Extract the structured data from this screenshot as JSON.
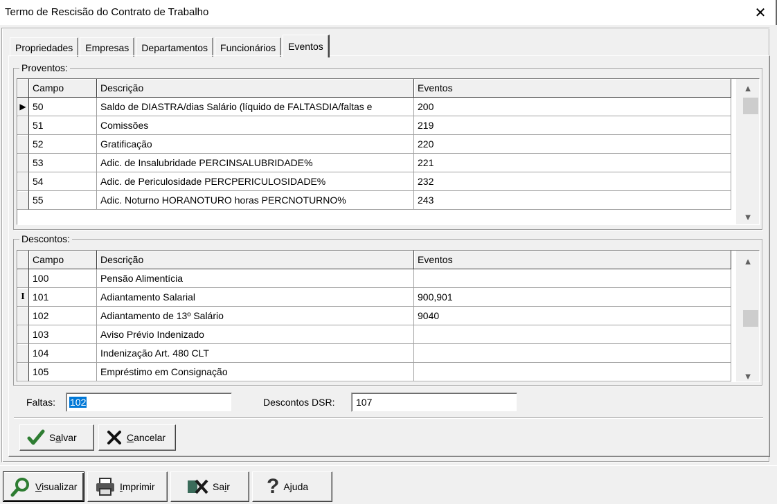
{
  "window": {
    "title": "Termo de Rescisão do Contrato de Trabalho",
    "close_glyph": "✕"
  },
  "tabs": [
    {
      "label": "Propriedades"
    },
    {
      "label": "Empresas"
    },
    {
      "label": "Departamentos"
    },
    {
      "label": "Funcionários"
    },
    {
      "label": "Eventos",
      "active": true
    }
  ],
  "proventos": {
    "label": "Proventos:",
    "columns": {
      "campo": "Campo",
      "descricao": "Descrição",
      "eventos": "Eventos"
    },
    "rows": [
      {
        "campo": "50",
        "descricao": "Saldo de DIASTRA/dias Salário (líquido de FALTASDIA/faltas e",
        "eventos": "200",
        "indicator": "▶"
      },
      {
        "campo": "51",
        "descricao": "Comissões",
        "eventos": "219"
      },
      {
        "campo": "52",
        "descricao": "Gratificação",
        "eventos": "220"
      },
      {
        "campo": "53",
        "descricao": "Adic. de Insalubridade PERCINSALUBRIDADE%",
        "eventos": "221"
      },
      {
        "campo": "54",
        "descricao": "Adic. de Periculosidade PERCPERICULOSIDADE%",
        "eventos": "232"
      },
      {
        "campo": "55",
        "descricao": "Adic. Noturno HORANOTURO horas PERCNOTURNO%",
        "eventos": "243"
      }
    ]
  },
  "descontos": {
    "label": "Descontos:",
    "columns": {
      "campo": "Campo",
      "descricao": "Descrição",
      "eventos": "Eventos"
    },
    "rows": [
      {
        "campo": "100",
        "descricao": "Pensão Alimentícia",
        "eventos": ""
      },
      {
        "campo": "101",
        "descricao": "Adiantamento Salarial",
        "eventos": "900,901",
        "indicator": "I"
      },
      {
        "campo": "102",
        "descricao": "Adiantamento de 13º Salário",
        "eventos": "9040"
      },
      {
        "campo": "103",
        "descricao": "Aviso Prévio Indenizado",
        "eventos": ""
      },
      {
        "campo": "104",
        "descricao": "Indenização Art. 480 CLT",
        "eventos": ""
      },
      {
        "campo": "105",
        "descricao": "Empréstimo em Consignação",
        "eventos": ""
      }
    ]
  },
  "fields": {
    "faltas_label": "Faltas:",
    "faltas_value": "102",
    "dsr_label": "Descontos DSR:",
    "dsr_value": "107"
  },
  "buttons": {
    "salvar_pre": "S",
    "salvar_u": "a",
    "salvar_post": "lvar",
    "cancelar_pre": "",
    "cancelar_u": "C",
    "cancelar_post": "ancelar",
    "visualizar_pre": "",
    "visualizar_u": "V",
    "visualizar_post": "isualizar",
    "imprimir_pre": "",
    "imprimir_u": "I",
    "imprimir_post": "mprimir",
    "sair_pre": "Sa",
    "sair_u": "i",
    "sair_post": "r",
    "ajuda_pre": "A",
    "ajuda_u": "j",
    "ajuda_post": "uda"
  },
  "colors": {
    "check": "#2e7d32",
    "cancel_x": "#111111",
    "selection": "#0078d7",
    "search": "#2e7d32"
  }
}
